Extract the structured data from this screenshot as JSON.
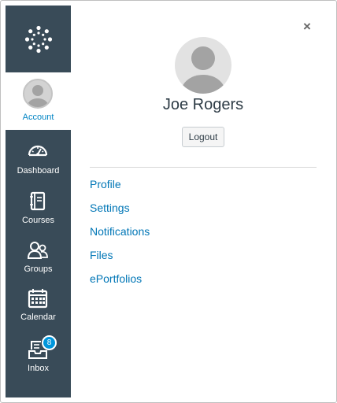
{
  "global_nav": {
    "logo_icon": "canvas-logo-icon",
    "account_label": "Account",
    "items": [
      {
        "label": "Dashboard",
        "icon": "dashboard-icon"
      },
      {
        "label": "Courses",
        "icon": "courses-icon"
      },
      {
        "label": "Groups",
        "icon": "groups-icon"
      },
      {
        "label": "Calendar",
        "icon": "calendar-icon"
      },
      {
        "label": "Inbox",
        "icon": "inbox-icon",
        "badge": "8"
      }
    ]
  },
  "tray": {
    "close_symbol": "×",
    "user_name": "Joe Rogers",
    "logout_label": "Logout",
    "links": [
      "Profile",
      "Settings",
      "Notifications",
      "Files",
      "ePortfolios"
    ]
  },
  "colors": {
    "nav_background": "#394b58",
    "link": "#0076b6",
    "badge": "#0096db"
  }
}
